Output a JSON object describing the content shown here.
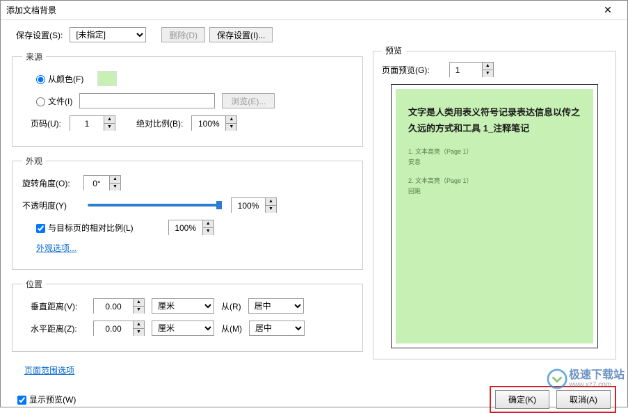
{
  "dialog": {
    "title": "添加文档背景",
    "close_glyph": "✕"
  },
  "saveSettings": {
    "label": "保存设置(S):",
    "selected": "[未指定]",
    "deleteBtn": "删除(D)",
    "saveBtn": "保存设置(I)..."
  },
  "source": {
    "legend": "来源",
    "fromColor": "从颜色(F)",
    "file": "文件(I)",
    "browseBtn": "浏览(E)...",
    "pageNumLabel": "页码(U):",
    "pageNumValue": "1",
    "absScaleLabel": "绝对比例(B):",
    "absScaleValue": "100%"
  },
  "appearance": {
    "legend": "外观",
    "rotateLabel": "旋转角度(O):",
    "rotateValue": "0°",
    "opacityLabel": "不透明度(Y)",
    "opacityValue": "100%",
    "relScaleLabel": "与目标页的相对比例(L)",
    "relScaleValue": "100%",
    "optionsLink": "外观选项..."
  },
  "position": {
    "legend": "位置",
    "vLabel": "垂直距离(V):",
    "vValue": "0.00",
    "hLabel": "水平距离(Z):",
    "hValue": "0.00",
    "unit": "厘米",
    "fromLabel1": "从(R)",
    "fromLabel2": "从(M)",
    "fromValue": "居中"
  },
  "pageRangeLink": "页面范围选项",
  "preview": {
    "legend": "预览",
    "pagePreviewLabel": "页面预览(G):",
    "pagePreviewValue": "1",
    "docTitle": "文字是人类用表义符号记录表达信息以传之久远的方式和工具 1_注释笔记",
    "item1": "1. 文本高亮（Page 1）",
    "item1sub": "安息",
    "item2": "2. 文本高亮（Page 1）",
    "item2sub": "回跑"
  },
  "bottom": {
    "showPreview": "显示预览(W)",
    "ok": "确定(K)",
    "cancel": "取消(A)"
  },
  "watermark": {
    "text1": "极速下载站",
    "text2": "www.xz7.com"
  }
}
